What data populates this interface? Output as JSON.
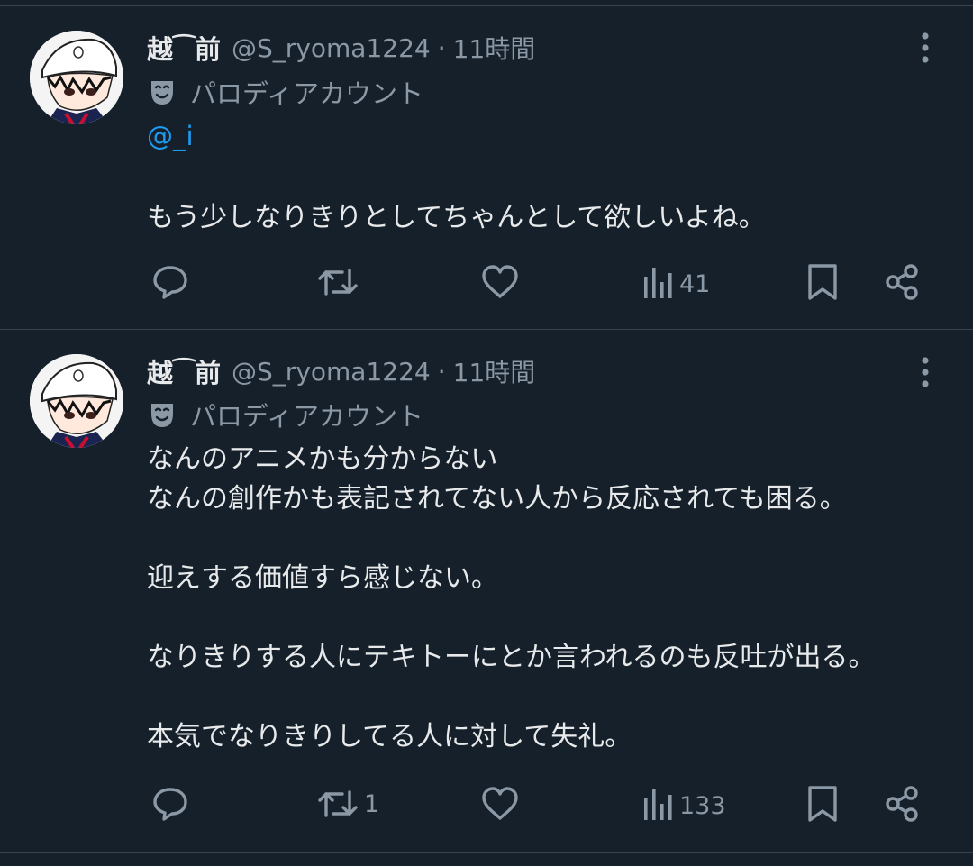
{
  "tweets": [
    {
      "display_name": "越⁀前",
      "handle": "@S_ryoma1224",
      "separator": "·",
      "time": "11時間",
      "parody_label": "パロディアカウント",
      "mention": "@_i",
      "lines": [
        "もう少しなりきりとしてちゃんとして欲しいよね。"
      ],
      "views": "41",
      "retweets": ""
    },
    {
      "display_name": "越⁀前",
      "handle": "@S_ryoma1224",
      "separator": "·",
      "time": "11時間",
      "parody_label": "パロディアカウント",
      "lines": [
        "なんのアニメかも分からない",
        "なんの創作かも表記されてない人から反応されても困る。",
        "",
        "迎えする価値すら感じない。",
        "",
        "なりきりする人にテキトーにとか言われるのも反吐が出る。",
        "",
        "本気でなりきりしてる人に対して失礼。"
      ],
      "views": "133",
      "retweets": "1"
    }
  ],
  "icons": {
    "more": "more-vertical-icon",
    "parody": "theater-mask-icon",
    "reply": "reply-icon",
    "retweet": "retweet-icon",
    "like": "heart-icon",
    "views": "views-chart-icon",
    "bookmark": "bookmark-icon",
    "share": "share-icon"
  },
  "colors": {
    "background": "#15202b",
    "text": "#e7e9ea",
    "secondary": "#8b98a5",
    "link": "#1d9bf0",
    "divider": "#38444d"
  }
}
